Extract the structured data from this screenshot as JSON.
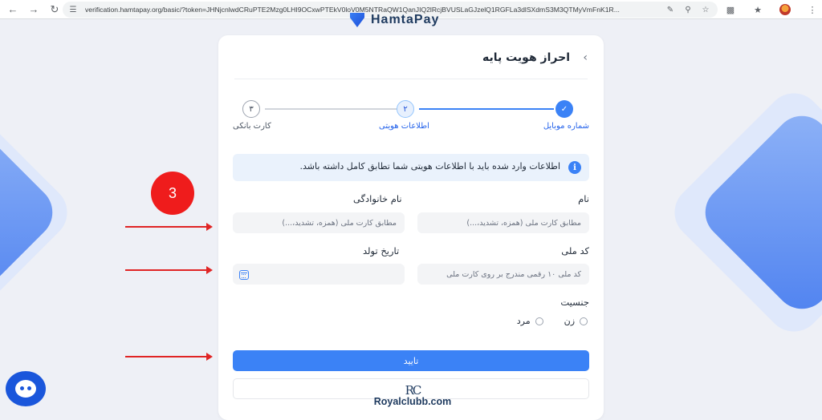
{
  "browser": {
    "url": "verification.hamtapay.org/basic/?token=JHNjcnlwdCRuPTE2Mzg0LHI9OCxwPTEkV0loV0M5NTRaQW1QanJIQ2lRcjBVUSLaGJzelQ1RGFLa3dlSXdmS3M3QTMyVmFnK1R..."
  },
  "logo": {
    "text": "HamtaPay"
  },
  "card": {
    "title": "احراز هویت پایه",
    "back": "‹"
  },
  "stepper": {
    "steps": [
      {
        "number": "✓",
        "label": "شماره موبایل",
        "state": "done"
      },
      {
        "number": "۲",
        "label": "اطلاعات هویتی",
        "state": "current"
      },
      {
        "number": "۳",
        "label": "کارت بانکی",
        "state": "todo"
      }
    ]
  },
  "info": {
    "icon": "i",
    "text": "اطلاعات وارد شده باید با اطلاعات هویتی شما تطابق کامل داشته باشد."
  },
  "form": {
    "first_name_label": "نام",
    "first_name_placeholder": "مطابق کارت ملی (همزه، تشدید،...)",
    "last_name_label": "نام خانوادگی",
    "last_name_placeholder": "مطابق کارت ملی (همزه، تشدید،...)",
    "national_code_label": "کد ملی",
    "national_code_placeholder": "کد ملی ۱۰ رقمی مندرج بر روی کارت ملی",
    "birth_date_label": "تاریخ تولد",
    "birth_date_value": "",
    "gender_label": "جنسیت",
    "gender_options": [
      "زن",
      "مرد"
    ],
    "submit_label": "تایید"
  },
  "annotation": {
    "marker_number": "3"
  },
  "watermark": {
    "mark": "RC",
    "text": "Royalclubb.com"
  },
  "colors": {
    "accent": "#3b82f6",
    "annotation_red": "#ef1c1c"
  }
}
